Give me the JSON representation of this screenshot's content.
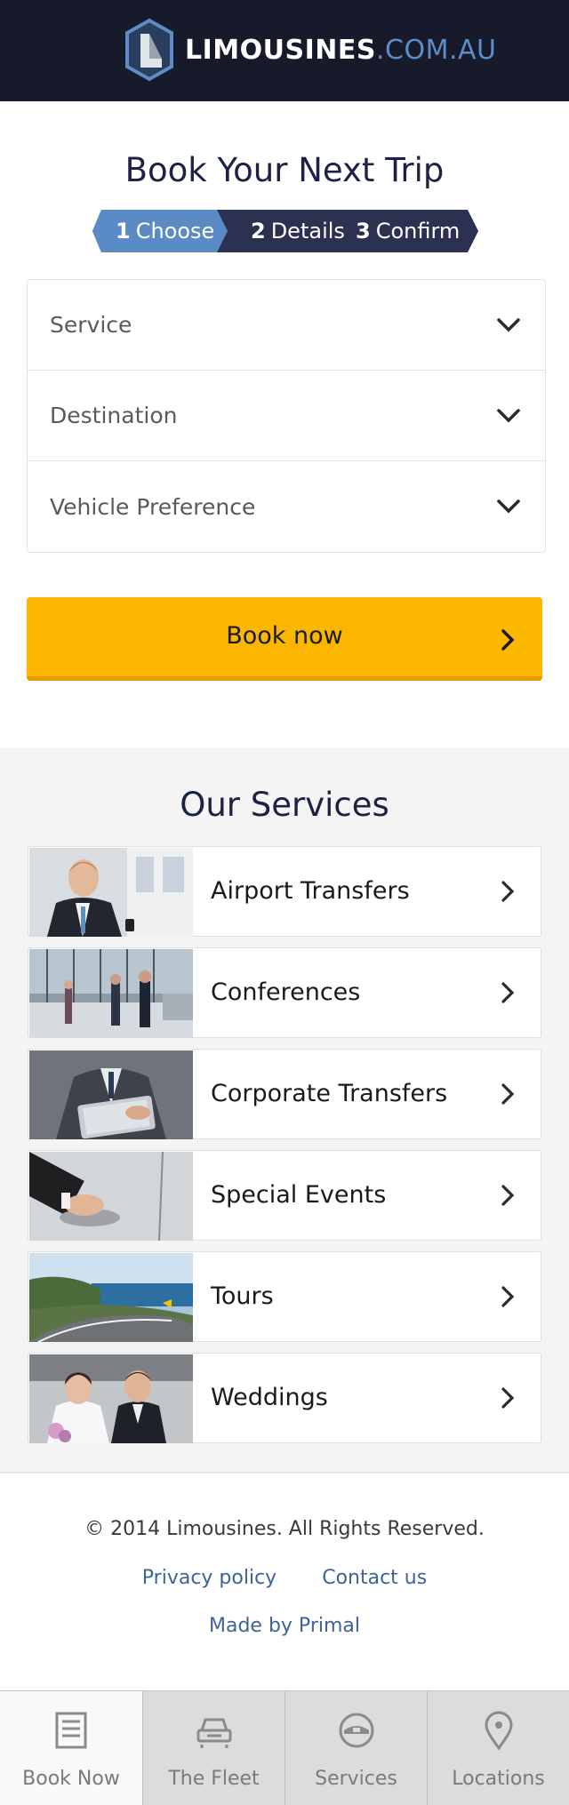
{
  "brand": {
    "name_main": "LIMOUSINES",
    "name_sub": ".COM.AU"
  },
  "booking": {
    "title": "Book Your Next Trip",
    "steps": [
      {
        "num": "1",
        "label": "Choose"
      },
      {
        "num": "2",
        "label": "Details"
      },
      {
        "num": "3",
        "label": "Confirm"
      }
    ],
    "fields": [
      {
        "label": "Service"
      },
      {
        "label": "Destination"
      },
      {
        "label": "Vehicle Preference"
      }
    ],
    "book_button": "Book now"
  },
  "services": {
    "title": "Our Services",
    "items": [
      {
        "label": "Airport Transfers"
      },
      {
        "label": "Conferences"
      },
      {
        "label": "Corporate Transfers"
      },
      {
        "label": "Special Events"
      },
      {
        "label": "Tours"
      },
      {
        "label": "Weddings"
      }
    ]
  },
  "footer": {
    "copyright": "© 2014 Limousines. All Rights Reserved.",
    "privacy": "Privacy policy",
    "contact": "Contact us",
    "made_by": "Made by Primal"
  },
  "tabbar": {
    "items": [
      {
        "label": "Book Now",
        "icon": "list-icon",
        "active": true
      },
      {
        "label": "The Fleet",
        "icon": "car-icon"
      },
      {
        "label": "Services",
        "icon": "chauffeur-hat-icon"
      },
      {
        "label": "Locations",
        "icon": "map-pin-icon"
      }
    ]
  },
  "colors": {
    "header_bg": "#171a2b",
    "accent_blue": "#5d8cc8",
    "step_active": "#5b8bc4",
    "step_inactive": "#2c3152",
    "book_button": "#fbb700",
    "link": "#3e6496"
  }
}
